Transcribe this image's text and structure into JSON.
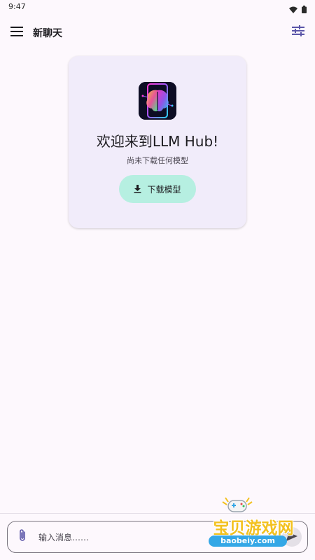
{
  "status_bar": {
    "time": "9:47"
  },
  "app_bar": {
    "title": "新聊天"
  },
  "welcome": {
    "title": "欢迎来到LLM Hub!",
    "subtitle": "尚未下载任何模型",
    "download_label": "下载模型"
  },
  "input_bar": {
    "placeholder": "输入消息……"
  },
  "watermark": {
    "title": "宝贝游戏网",
    "url": "baobeiy.com"
  },
  "colors": {
    "background": "#fdf8fd",
    "card": "#f1ecfa",
    "download_button": "#b6efe1",
    "accent": "#5b55a8",
    "watermark_yellow": "#f3c11f",
    "watermark_blue": "#34a7e6"
  }
}
